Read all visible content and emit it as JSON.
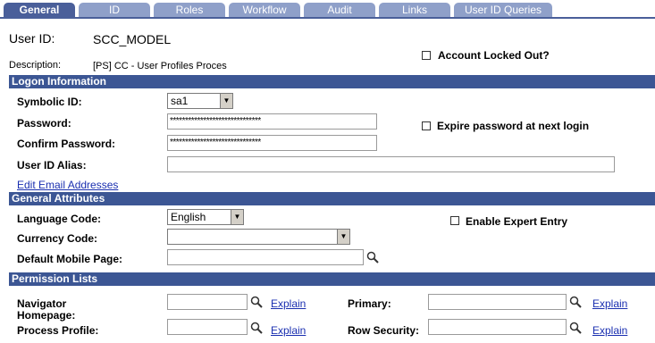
{
  "tabs": [
    "General",
    "ID",
    "Roles",
    "Workflow",
    "Audit",
    "Links",
    "User ID Queries"
  ],
  "user": {
    "id_label": "User ID:",
    "id_value": "SCC_MODEL",
    "desc_label": "Description:",
    "desc_value": "[PS] CC - User Profiles Proces",
    "account_locked_label": "Account Locked Out?"
  },
  "logon": {
    "header": "Logon Information",
    "symbolic_id_label": "Symbolic ID:",
    "symbolic_id_value": "sa1",
    "password_label": "Password:",
    "password_value": "******************************",
    "confirm_label": "Confirm Password:",
    "confirm_value": "******************************",
    "expire_label": "Expire password at next login",
    "alias_label": "User ID Alias:",
    "alias_value": "",
    "edit_email_link": "Edit Email Addresses"
  },
  "general": {
    "header": "General Attributes",
    "language_label": "Language Code:",
    "language_value": "English",
    "currency_label": "Currency Code:",
    "currency_value": "",
    "mobile_label": "Default Mobile Page:",
    "mobile_value": "",
    "expert_label": "Enable Expert Entry"
  },
  "perm": {
    "header": "Permission Lists",
    "nav_label_1": "Navigator",
    "nav_label_2": "Homepage:",
    "process_label": "Process Profile:",
    "primary_label": "Primary:",
    "row_label": "Row Security:",
    "explain": "Explain"
  },
  "colors": {
    "tab_inactive": "#8fa0c9",
    "tab_active": "#4a5f9a",
    "section": "#3c5694",
    "link": "#1a2fb0"
  }
}
